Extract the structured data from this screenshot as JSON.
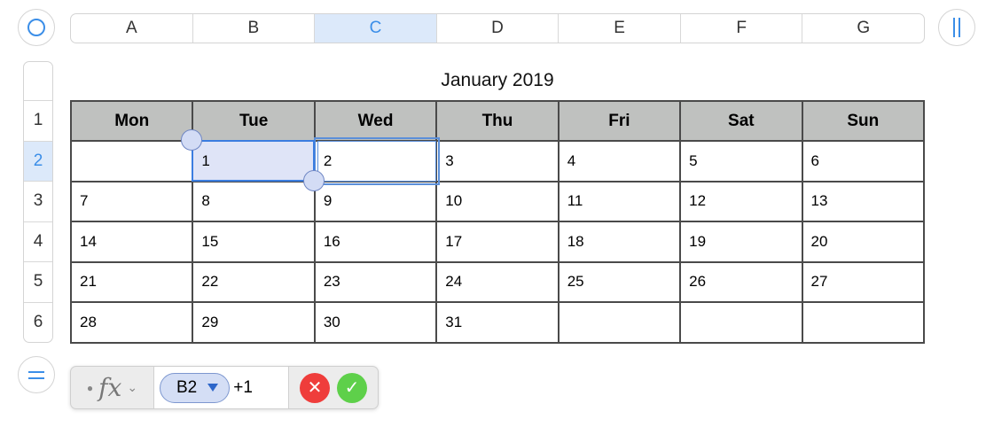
{
  "column_header": {
    "columns": [
      "A",
      "B",
      "C",
      "D",
      "E",
      "F",
      "G"
    ],
    "selected": "C"
  },
  "row_header": {
    "rows": [
      "1",
      "2",
      "3",
      "4",
      "5",
      "6"
    ],
    "selected": "2"
  },
  "calendar": {
    "title": "January 2019",
    "weekdays": [
      "Mon",
      "Tue",
      "Wed",
      "Thu",
      "Fri",
      "Sat",
      "Sun"
    ],
    "weeks": [
      [
        "",
        "1",
        "2",
        "3",
        "4",
        "5",
        "6"
      ],
      [
        "7",
        "8",
        "9",
        "10",
        "11",
        "12",
        "13"
      ],
      [
        "14",
        "15",
        "16",
        "17",
        "18",
        "19",
        "20"
      ],
      [
        "21",
        "22",
        "23",
        "24",
        "25",
        "26",
        "27"
      ],
      [
        "28",
        "29",
        "30",
        "31",
        "",
        "",
        ""
      ]
    ]
  },
  "formula_bar": {
    "fx_label": "fx",
    "cell_reference": "B2",
    "formula_suffix": "+1"
  },
  "icons": {
    "table_handle": "circle-icon",
    "column_handle": "pause-bars-icon",
    "row_handle": "equals-icon",
    "cancel": "x-icon",
    "confirm": "checkmark-icon"
  },
  "colors": {
    "selection_blue": "#3b8ee8",
    "header_highlight": "#dce9fa",
    "weekday_header_bg": "#bfc1bf",
    "cancel_red": "#ef3d3b",
    "confirm_green": "#5ed04a"
  }
}
